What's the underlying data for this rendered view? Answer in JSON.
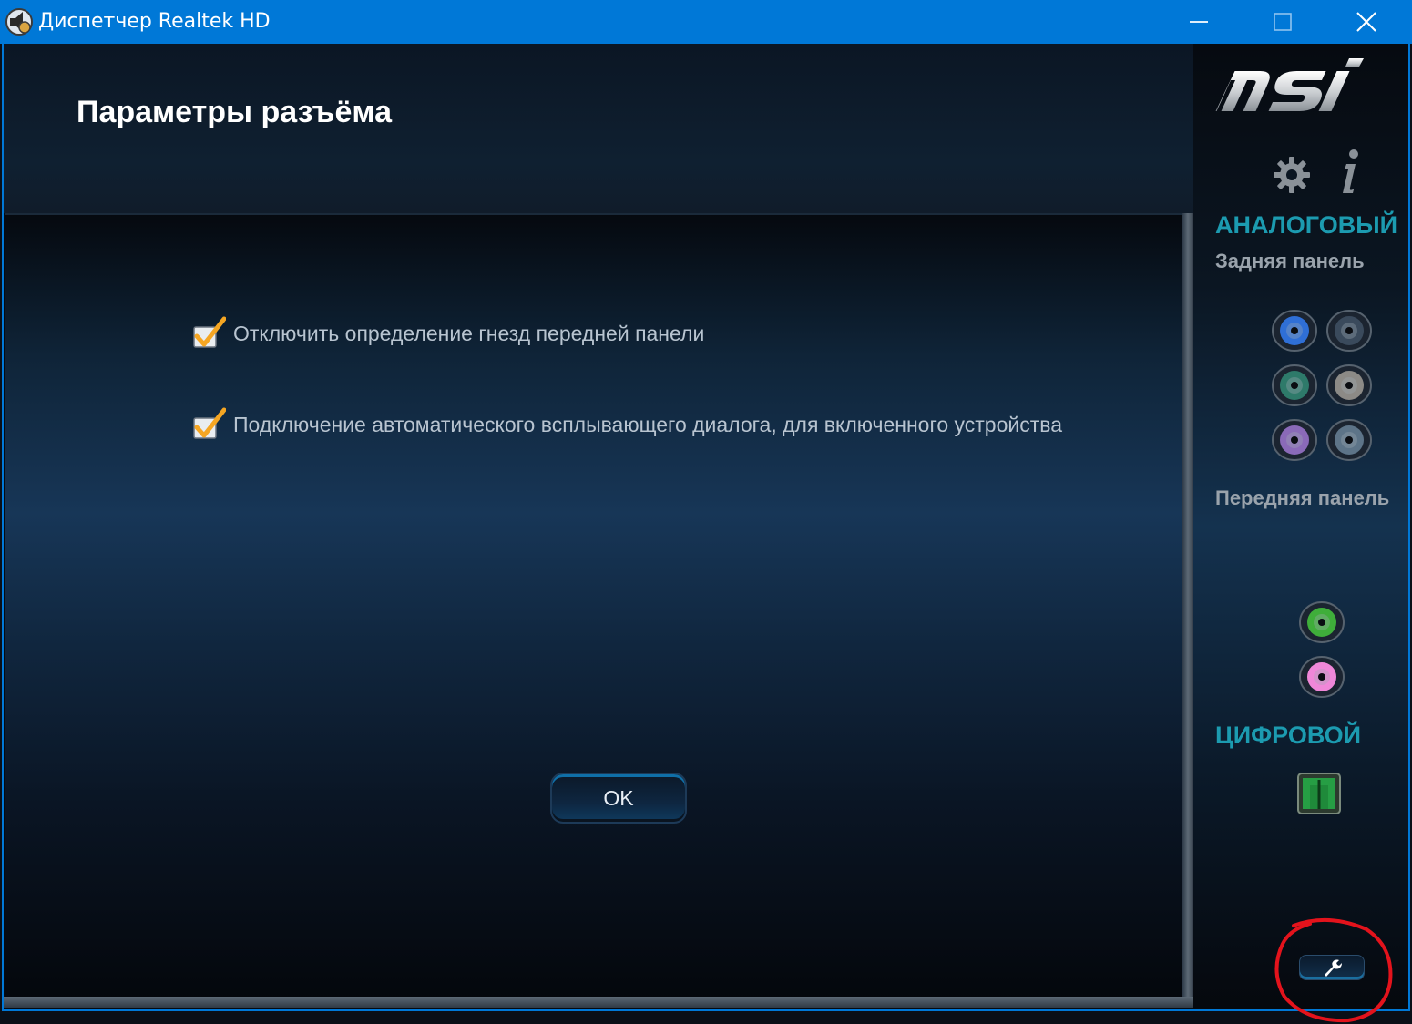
{
  "window": {
    "title": "Диспетчер Realtek HD",
    "accent_color": "#0078d7"
  },
  "header": {
    "title": "Параметры разъёма"
  },
  "options": [
    {
      "label": "Отключить определение гнезд передней панели",
      "checked": true
    },
    {
      "label": "Подключение автоматического всплывающего диалога, для включенного устройства",
      "checked": true
    }
  ],
  "buttons": {
    "ok_label": "OK"
  },
  "sidebar": {
    "brand_icon": "msi-logo",
    "analog_title": "АНАЛОГОВЫЙ",
    "rear_panel_title": "Задняя панель",
    "front_panel_title": "Передняя панель",
    "digital_title": "ЦИФРОВОЙ",
    "rear_jacks": [
      {
        "color": "#2f6fd6",
        "active": true
      },
      {
        "color": "#3a4a5c",
        "active": false
      },
      {
        "color": "#2e7a6a",
        "active": false
      },
      {
        "color": "#8c8a86",
        "active": false
      },
      {
        "color": "#8a6ab8",
        "active": false
      },
      {
        "color": "#5d7488",
        "active": false
      }
    ],
    "front_jacks": [
      {
        "color": "#3fae3a",
        "active": true
      },
      {
        "color": "#f087d8",
        "active": true
      }
    ],
    "accent_color": "#1c9bb0"
  }
}
